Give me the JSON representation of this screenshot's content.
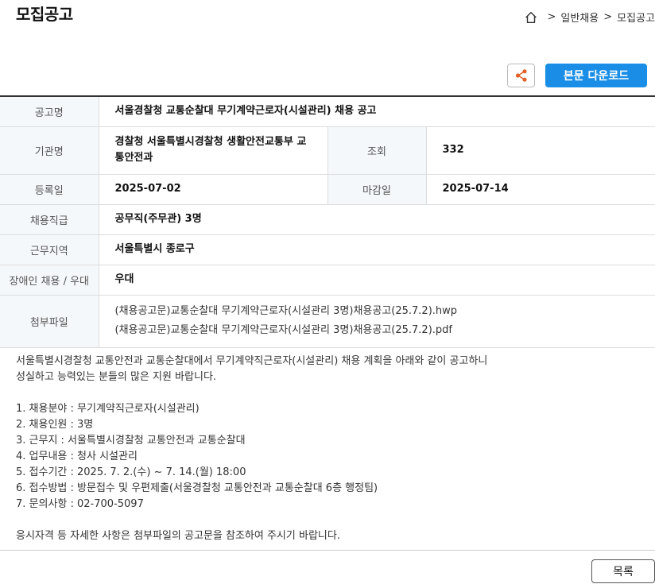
{
  "page": {
    "title": "모집공고"
  },
  "breadcrumb": {
    "sep1": ">",
    "item1": "일반채용",
    "sep2": ">",
    "item2": "모집공고"
  },
  "toolbar": {
    "download_label": "본문 다운로드"
  },
  "info": {
    "title_label": "공고명",
    "title_value": "서울경찰청 교통순찰대 무기계약근로자(시설관리) 채용 공고",
    "org_label": "기관명",
    "org_value": "경찰청 서울특별시경찰청 생활안전교통부 교통안전과",
    "views_label": "조회",
    "views_value": "332",
    "reg_label": "등록일",
    "reg_value": "2025-07-02",
    "deadline_label": "마감일",
    "deadline_value": "2025-07-14",
    "position_label": "채용직급",
    "position_value": "공무직(주무관) 3명",
    "region_label": "근무지역",
    "region_value": "서울특별시 종로구",
    "disabled_label": "장애인 채용 / 우대",
    "disabled_value": "우대",
    "files_label": "첨부파일",
    "files": [
      "(채용공고문)교통순찰대 무기계약근로자(시설관리 3명)채용공고(25.7.2).hwp",
      "(채용공고문)교통순찰대 무기계약근로자(시설관리 3명)채용공고(25.7.2).pdf"
    ]
  },
  "body": {
    "lines": [
      "서울특별시경찰청 교통안전과 교통순찰대에서 무기계약직근로자(시설관리) 채용 계획을 아래와 같이 공고하니",
      "성실하고 능력있는 분들의 많은 지원 바랍니다.",
      "",
      "1. 채용분야 : 무기계약직근로자(시설관리)",
      "2. 채용인원 : 3명",
      "3. 근무지 : 서울특별시경찰청 교통안전과 교통순찰대",
      "4. 업무내용 : 청사 시설관리",
      "5. 접수기간 : 2025. 7. 2.(수) ~ 7. 14.(월) 18:00",
      "6. 접수방법 : 방문접수 및 우편제출(서울경찰청 교통안전과 교통순찰대 6층 행정팀)",
      "7. 문의사항 : 02-700-5097",
      "",
      "응시자격 등 자세한 사항은 첨부파일의 공고문을 참조하여 주시기 바랍니다."
    ]
  },
  "footer": {
    "list_label": "목록"
  },
  "colors": {
    "accent": "#1a8ee6",
    "share_icon": "#e2622a",
    "header_cell_bg": "#f5f8fb"
  }
}
